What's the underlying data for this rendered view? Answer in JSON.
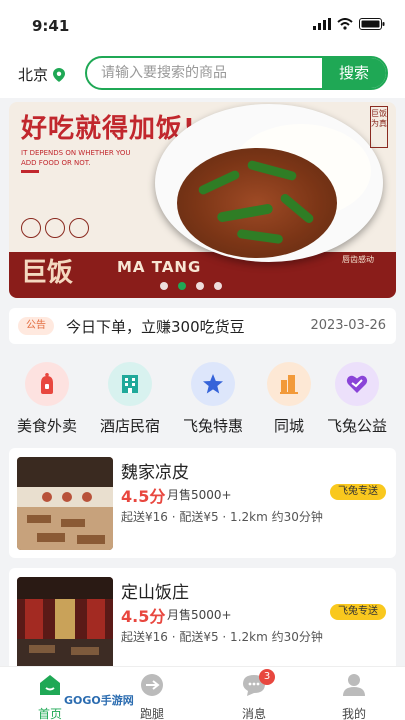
{
  "status": {
    "time": "9:41"
  },
  "header": {
    "city": "北京",
    "search_placeholder": "请输入要搜索的商品",
    "search_button": "搜索"
  },
  "banner": {
    "title": "好吃就得加饭!",
    "subtitle": "IT DEPENDS ON WHETHER YOU ADD FOOD OR NOT.",
    "brand_cn": "巨饭",
    "brand_en": "MA TANG",
    "stamp": "巨饭为真",
    "slogan": "唇齿感动",
    "slides": 4,
    "active_slide": 2
  },
  "notice": {
    "tag": "公告",
    "text": "今日下单，立赚300吃货豆",
    "date": "2023-03-26"
  },
  "categories": [
    {
      "label": "美食外卖",
      "icon": "food-delivery-icon",
      "color": "#fde2e0",
      "fg": "#e8473f"
    },
    {
      "label": "酒店民宿",
      "icon": "hotel-icon",
      "color": "#d8f2ef",
      "fg": "#20a99a"
    },
    {
      "label": "飞兔特惠",
      "icon": "star-icon",
      "color": "#dde6fb",
      "fg": "#3563d9"
    },
    {
      "label": "同城",
      "icon": "city-icon",
      "color": "#fde8d5",
      "fg": "#f29a3a"
    },
    {
      "label": "飞兔公益",
      "icon": "heart-icon",
      "color": "#ece0fb",
      "fg": "#8a44d8"
    }
  ],
  "shops": [
    {
      "name": "魏家凉皮",
      "rating": "4.5分",
      "sales": "月售5000+",
      "badge": "飞兔专送",
      "info": "起送¥16 · 配送¥5 · 1.2km 约30分钟"
    },
    {
      "name": "定山饭庄",
      "rating": "4.5分",
      "sales": "月售5000+",
      "badge": "飞兔专送",
      "info": "起送¥16 · 配送¥5 · 1.2km 约30分钟"
    }
  ],
  "tabbar": {
    "items": [
      {
        "label": "首页",
        "icon": "home-icon"
      },
      {
        "label": "跑腿",
        "icon": "errand-icon"
      },
      {
        "label": "消息",
        "icon": "message-icon",
        "badge": "3"
      },
      {
        "label": "我的",
        "icon": "profile-icon"
      }
    ]
  },
  "watermark": "GOGO手游网",
  "colors": {
    "brand": "#1fa855",
    "accent": "#e8473f",
    "badge": "#f9c81e"
  }
}
